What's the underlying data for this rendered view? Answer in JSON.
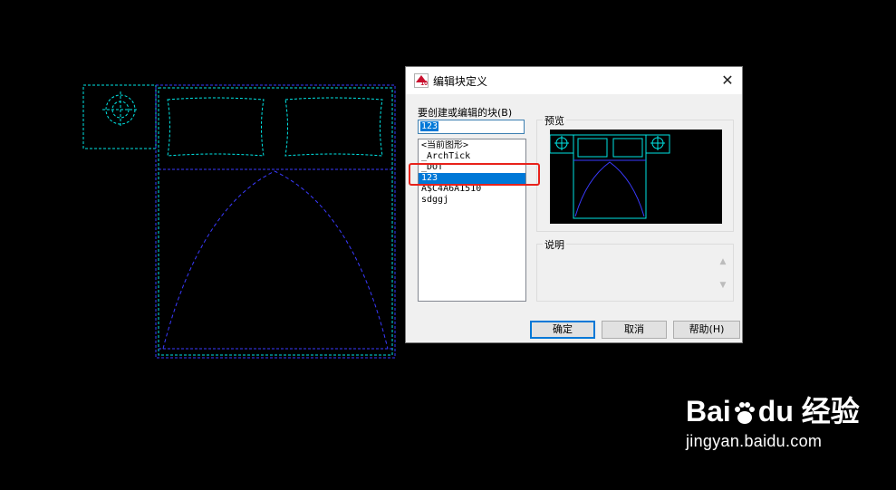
{
  "dialog": {
    "title": "编辑块定义",
    "app_icon_label": "A",
    "app_icon_version": "10",
    "close_label": "✕",
    "label_block_name": "要创建或编辑的块(B)",
    "input_value": "123",
    "block_list": [
      {
        "label": "<当前图形>",
        "selected": false
      },
      {
        "label": "_ArchTick",
        "selected": false
      },
      {
        "label": "_DOT",
        "selected": false
      },
      {
        "label": "123",
        "selected": true
      },
      {
        "label": "A$C4A6A1510",
        "selected": false
      },
      {
        "label": "sdggj",
        "selected": false
      }
    ],
    "preview_label": "预览",
    "description_label": "说明",
    "buttons": {
      "ok": "确定",
      "cancel": "取消",
      "help": "帮助(H)"
    }
  },
  "watermark": {
    "brand": "Bai",
    "brand_suffix": "du",
    "brand_cn": "经验",
    "url": "jingyan.baidu.com"
  },
  "colors": {
    "cad_background": "#000000",
    "cad_cyan": "#00e5e5",
    "cad_blue": "#3a3aff",
    "highlight_red": "#e8221b",
    "selection_blue": "#0078d7"
  }
}
